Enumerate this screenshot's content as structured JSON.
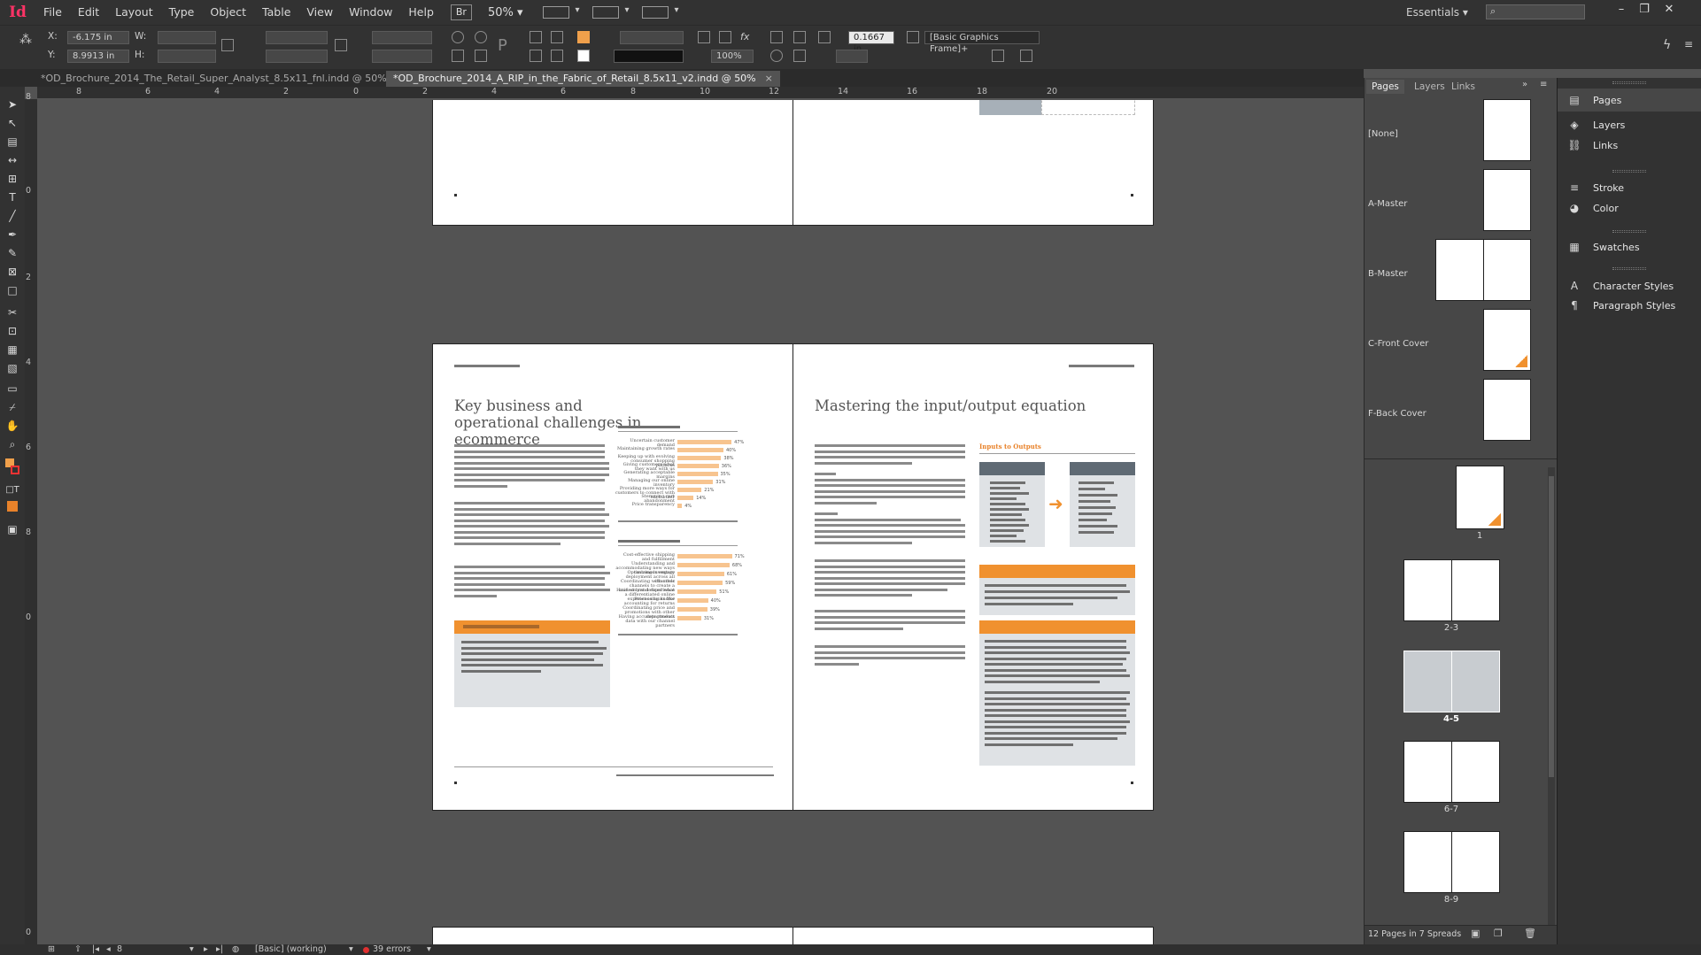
{
  "menubar": {
    "logo": "Id",
    "items": [
      "File",
      "Edit",
      "Layout",
      "Type",
      "Object",
      "Table",
      "View",
      "Window",
      "Help"
    ],
    "bridge_label": "Br",
    "zoom": "50%",
    "workspace": "Essentials",
    "workspace_arrow": "▾"
  },
  "control": {
    "x_label": "X:",
    "x_value": "-6.175 in",
    "y_label": "Y:",
    "y_value": "8.9913 in",
    "w_label": "W:",
    "h_label": "H:",
    "stroke_weight": "0.1667 in",
    "opacity": "100%",
    "object_style": "[Basic Graphics Frame]+"
  },
  "tabs": [
    {
      "label": "*OD_Brochure_2014_The_Retail_Super_Analyst_8.5x11_fnl.indd @ 50%",
      "close": "×"
    },
    {
      "label": "*OD_Brochure_2014_A_RIP_in_the_Fabric_of_Retail_8.5x11_v2.indd @ 50%",
      "close": "×"
    }
  ],
  "ruler": {
    "h_ticks": [
      "8",
      "6",
      "4",
      "2",
      "0",
      "2",
      "4",
      "6",
      "8",
      "10",
      "12",
      "14",
      "16",
      "18",
      "20"
    ],
    "v_ticks": [
      "8",
      "0",
      "2",
      "4",
      "6",
      "8",
      "0",
      "0"
    ]
  },
  "document": {
    "left_heading": "Key business and operational challenges in ecommerce",
    "right_heading": "Mastering the input/output equation",
    "chart_title": "Inputs to Outputs",
    "bars_top": [
      {
        "label": "Uncertain customer demand",
        "pct": "47%",
        "value": 47
      },
      {
        "label": "Maintaining growth rates",
        "pct": "40%",
        "value": 40
      },
      {
        "label": "Keeping up with evolving consumer shopping patterns",
        "pct": "38%",
        "value": 38
      },
      {
        "label": "Giving customers what they want with us",
        "pct": "36%",
        "value": 36
      },
      {
        "label": "Generating acceptable margins",
        "pct": "35%",
        "value": 35
      },
      {
        "label": "Managing our online inventory",
        "pct": "31%",
        "value": 31
      },
      {
        "label": "Providing more ways for customers to connect with each other",
        "pct": "21%",
        "value": 21
      },
      {
        "label": "Stemming cart abandonment",
        "pct": "14%",
        "value": 14
      },
      {
        "label": "Price transparency",
        "pct": "4%",
        "value": 4
      }
    ],
    "bars_bottom": [
      {
        "label": "Cost-effective shipping and fulfillment",
        "pct": "71%",
        "value": 71
      },
      {
        "label": "Understanding and accommodating new ways customers engage",
        "pct": "68%",
        "value": 68
      },
      {
        "label": "Optimizing inventory deployment across all channels",
        "pct": "61%",
        "value": 61
      },
      {
        "label": "Coordinating with other channels to create a unified brand experience",
        "pct": "59%",
        "value": 59
      },
      {
        "label": "Have we yet defined what a differentiated online experience looks like",
        "pct": "51%",
        "value": 51
      },
      {
        "label": "Processing and/or accounting for returns",
        "pct": "40%",
        "value": 40
      },
      {
        "label": "Coordinating price and promotions with other departments",
        "pct": "39%",
        "value": 39
      },
      {
        "label": "Having accurate product data with our channel partners",
        "pct": "31%",
        "value": 31
      }
    ]
  },
  "pages_panel": {
    "tabs": [
      "Pages",
      "Layers",
      "Links"
    ],
    "masters": [
      "[None]",
      "A-Master",
      "B-Master",
      "C-Front Cover",
      "F-Back Cover"
    ],
    "spreads": [
      "1",
      "2-3",
      "4-5",
      "6-7",
      "8-9"
    ],
    "footer": "12 Pages in 7 Spreads"
  },
  "dock": {
    "items": [
      "Pages",
      "Layers",
      "Links",
      "Stroke",
      "Color",
      "Swatches",
      "Character Styles",
      "Paragraph Styles"
    ]
  },
  "status": {
    "page": "8",
    "profile": "[Basic] (working)",
    "errors": "39 errors"
  },
  "colors": {
    "accent_orange": "#f0a04b",
    "app_pink": "#ff3366",
    "panel_dark": "#323232"
  }
}
